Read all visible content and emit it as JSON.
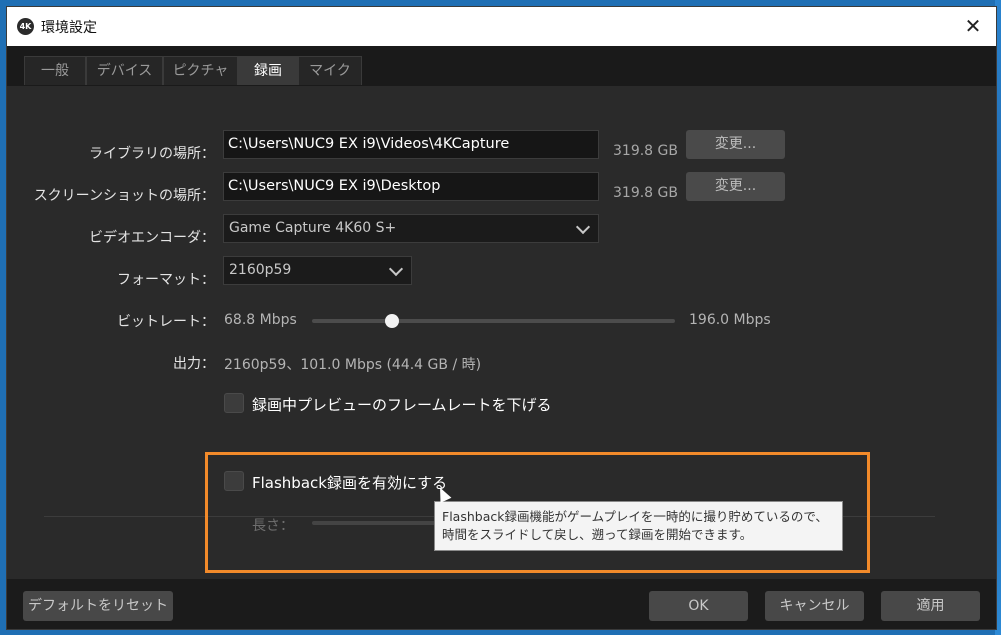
{
  "window": {
    "title": "環境設定",
    "logo_text": "4K",
    "close_glyph": "✕"
  },
  "tabs": [
    {
      "label": "一般",
      "active": false
    },
    {
      "label": "デバイス",
      "active": false
    },
    {
      "label": "ピクチャ",
      "active": false
    },
    {
      "label": "録画",
      "active": true
    },
    {
      "label": "マイク",
      "active": false
    }
  ],
  "library": {
    "label": "ライブラリの場所：",
    "path": "C:\\Users\\NUC9 EX i9\\Videos\\4KCapture",
    "size": "319.8 GB",
    "change_label": "変更..."
  },
  "screenshot": {
    "label": "スクリーンショットの場所：",
    "path": "C:\\Users\\NUC9 EX i9\\Desktop",
    "size": "319.8 GB",
    "change_label": "変更..."
  },
  "encoder": {
    "label": "ビデオエンコーダ：",
    "value": "Game Capture 4K60 S+"
  },
  "format": {
    "label": "フォーマット：",
    "value": "2160p59"
  },
  "bitrate": {
    "label": "ビットレート：",
    "min": "68.8 Mbps",
    "max": "196.0 Mbps",
    "position": 0.22
  },
  "output": {
    "label": "出力：",
    "value": "2160p59、101.0 Mbps (44.4 GB / 時)"
  },
  "lower_fps": {
    "label": "録画中プレビューのフレームレートを下げる",
    "checked": false
  },
  "flashback": {
    "label": "Flashback録画を有効にする",
    "checked": false,
    "length_label": "長さ：",
    "tooltip_line1": "Flashback録画機能がゲームプレイを一時的に撮り貯めているので、",
    "tooltip_line2": "時間をスライドして戻し、遡って録画を開始できます。"
  },
  "footer": {
    "reset_label": "デフォルトをリセット",
    "ok_label": "OK",
    "cancel_label": "キャンセル",
    "apply_label": "適用"
  },
  "colors": {
    "highlight": "#f28a2a",
    "background": "#2a2a2a",
    "active_tab": "#3a3a3a"
  },
  "icons": {
    "close": "close-icon",
    "dropdown": "chevron-down-icon",
    "cursor": "mouse-cursor-icon"
  }
}
